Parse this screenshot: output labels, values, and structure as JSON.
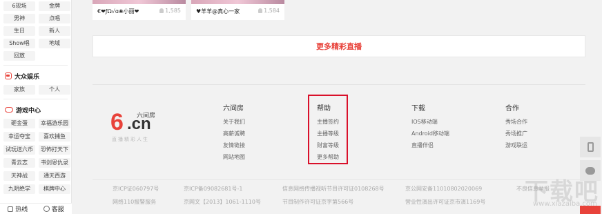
{
  "sidebar": {
    "rows_top": [
      [
        "6现场",
        "金牌"
      ],
      [
        "男神",
        "点唱"
      ],
      [
        "生日",
        "新人"
      ],
      [
        "Show唱",
        "地域"
      ],
      [
        "回放",
        ""
      ]
    ],
    "entertainment": {
      "title": "大众娱乐",
      "items": [
        "家族",
        "个人"
      ]
    },
    "games": {
      "title": "游戏中心",
      "items": [
        [
          "砸金蛋",
          "幸福游乐园"
        ],
        [
          "幸运夺宝",
          "喜欢捕鱼"
        ],
        [
          "试玩送六币",
          "恐怖打天下"
        ],
        [
          "青云志",
          "书剑恩仇录"
        ],
        [
          "天神战",
          "通天西游"
        ],
        [
          "九阴绝学",
          "棋牌中心"
        ]
      ]
    },
    "footer": {
      "hotline": "热线",
      "service": "客服"
    }
  },
  "cards": [
    {
      "name": "€❤ƒΩ√ɑ❀小丽❤",
      "count": "1,585"
    },
    {
      "name": "♥羊羊@真心一家",
      "count": "1,584"
    }
  ],
  "more_live": "更多精彩直播",
  "logo": {
    "name": "六间房",
    "slogan": "直播精彩人生"
  },
  "footer_columns": [
    {
      "title": "六间房",
      "links": [
        "关于我们",
        "高薪诚聘",
        "友情链接",
        "网站地图"
      ]
    },
    {
      "title": "帮助",
      "links": [
        "主播签约",
        "主播等级",
        "财富等级",
        "更多帮助"
      ]
    },
    {
      "title": "下载",
      "links": [
        "IOS移动端",
        "Android移动端",
        "直播伴侣"
      ]
    },
    {
      "title": "合作",
      "links": [
        "秀场合作",
        "秀场推广",
        "游戏联运"
      ]
    }
  ],
  "legal": {
    "row1": [
      "京ICP证060797号",
      "京ICP备09082681号-1",
      "信息网络传播视听节目许可证0108268号",
      "京公网安备11010802020069",
      "不良信息举报"
    ],
    "row2": [
      "网络110报警服务",
      "京网文【2013】1061-1110号",
      "节目制作许可证京字第566号",
      "营业性演出许可证京市演1169号"
    ]
  },
  "watermark": {
    "text": "下载吧",
    "url": "www.xiazaiba.com"
  },
  "colors": {
    "accent": "#e8423a",
    "highlight_box": "#d9102a"
  }
}
